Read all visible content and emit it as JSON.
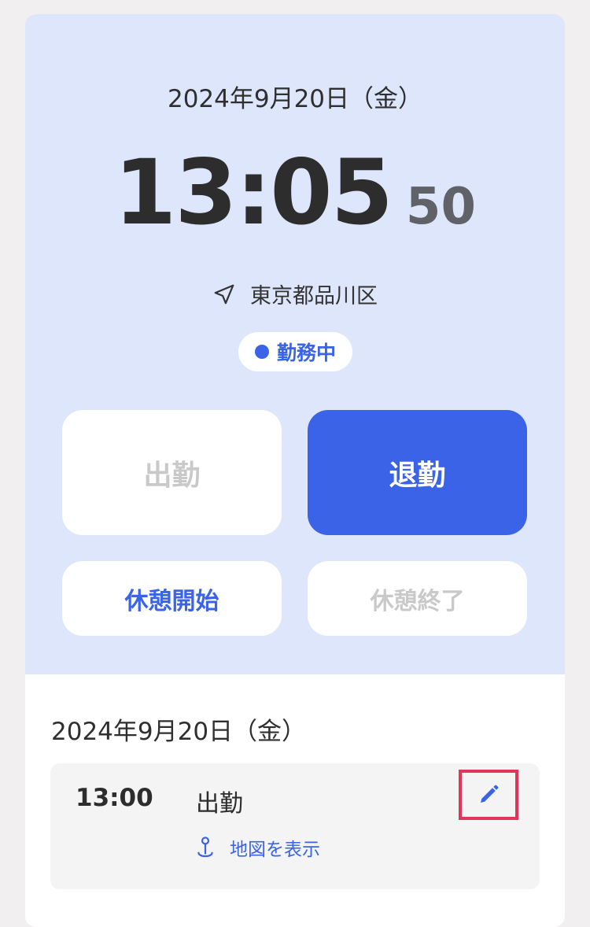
{
  "clock": {
    "date": "2024年9月20日（金）",
    "hours_minutes": "13:05",
    "seconds": "50",
    "location": "東京都品川区",
    "status": "勤務中"
  },
  "buttons": {
    "clock_in": "出勤",
    "clock_out": "退勤",
    "break_start": "休憩開始",
    "break_end": "休憩終了"
  },
  "log": {
    "date": "2024年9月20日（金）",
    "items": [
      {
        "time": "13:00",
        "type": "出勤",
        "map_link": "地図を表示"
      }
    ]
  },
  "icons": {
    "location": "navigation-arrow-icon",
    "map": "map-pin-icon",
    "edit": "pencil-icon"
  },
  "colors": {
    "accent": "#3a63e8",
    "panel_bg": "#dde6fb",
    "highlight": "#e5345c"
  }
}
